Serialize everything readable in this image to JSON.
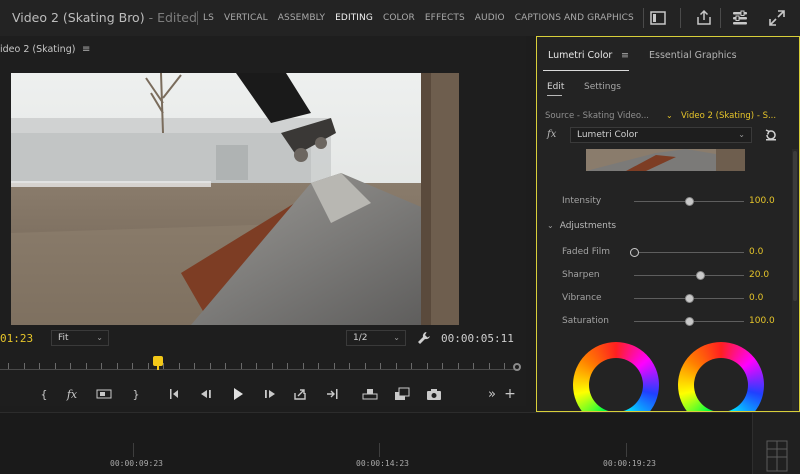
{
  "app": {
    "project_title": "Video 2 (Skating Bro)",
    "title_sep": " - ",
    "edited_label": "Edited"
  },
  "workspaces": [
    "LS",
    "VERTICAL",
    "ASSEMBLY",
    "EDITING",
    "COLOR",
    "EFFECTS",
    "AUDIO",
    "CAPTIONS AND GRAPHICS"
  ],
  "active_workspace": "EDITING",
  "program_monitor": {
    "title": "ideo 2 (Skating)",
    "current_timecode": "01:23",
    "zoom_select": "Fit",
    "resolution_select": "1/2",
    "duration_timecode": "00:00:05:11",
    "playhead_fraction": 0.3
  },
  "lumetri": {
    "tabs": [
      "Lumetri Color",
      "Essential Graphics"
    ],
    "subtabs": [
      "Edit",
      "Settings"
    ],
    "source_label": "Source - Skating Video...",
    "target_label": "Video 2 (Skating) - S...",
    "fx_label": "fx",
    "effect_select": "Lumetri Color",
    "intensity": {
      "label": "Intensity",
      "value": "100.0",
      "fraction": 0.5
    },
    "adjustments_label": "Adjustments",
    "params": [
      {
        "label": "Faded Film",
        "value": "0.0",
        "fraction": 0.0
      },
      {
        "label": "Sharpen",
        "value": "20.0",
        "fraction": 0.6
      },
      {
        "label": "Vibrance",
        "value": "0.0",
        "fraction": 0.5
      },
      {
        "label": "Saturation",
        "value": "100.0",
        "fraction": 0.5
      }
    ]
  },
  "timeline": {
    "timecodes": [
      "00:00:09:23",
      "00:00:14:23",
      "00:00:19:23"
    ]
  },
  "colors": {
    "accent_yellow": "#e6c52a",
    "panel_border": "#d8cf3a",
    "background": "#1d1d1d"
  },
  "icons": [
    "panel-icon",
    "export-icon",
    "sliders-icon",
    "expand-icon",
    "wrench-icon",
    "reset-icon"
  ]
}
